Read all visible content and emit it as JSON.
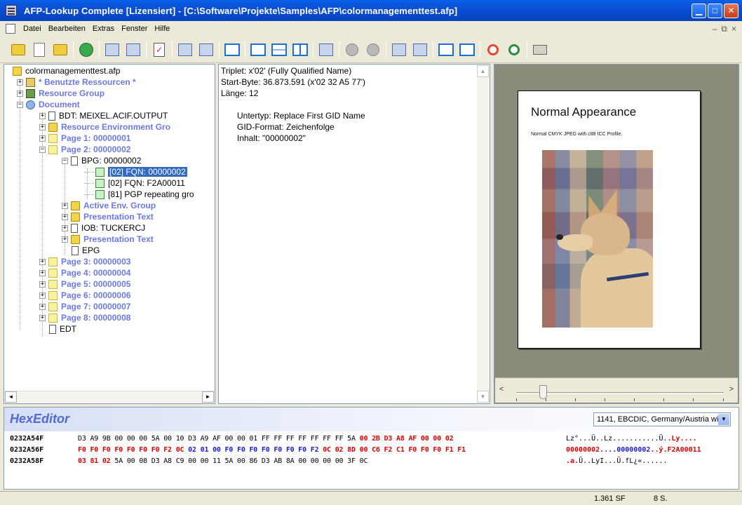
{
  "window": {
    "title": "AFP-Lookup Complete   [Lizensiert] - [C:\\Software\\Projekte\\Samples\\AFP\\colormanagementtest.afp]",
    "min": "▁",
    "max": "□",
    "close": "✕"
  },
  "menu": {
    "items": [
      "Datei",
      "Bearbeiten",
      "Extras",
      "Fenster",
      "Hilfe"
    ],
    "mdi_min": "–",
    "mdi_restore": "⧉",
    "mdi_close": "×"
  },
  "tree": {
    "items": [
      {
        "label": "colormanagementtest.afp"
      },
      {
        "label": "* Benutzte Ressourcen *"
      },
      {
        "label": "Resource Group"
      },
      {
        "label": "Document"
      },
      {
        "label": "BDT: MEIXEL.ACIF.OUTPUT"
      },
      {
        "label": "Resource Environment Gro"
      },
      {
        "label": "Page 1: 00000001"
      },
      {
        "label": "Page 2: 00000002"
      },
      {
        "label": "BPG: 00000002"
      },
      {
        "label": "[02] FQN: 00000002"
      },
      {
        "label": "[02] FQN: F2A00011"
      },
      {
        "label": "[81] PGP repeating gro"
      },
      {
        "label": "Active Env. Group"
      },
      {
        "label": "Presentation Text"
      },
      {
        "label": "IOB: TUCKERCJ"
      },
      {
        "label": "Presentation Text"
      },
      {
        "label": "EPG"
      },
      {
        "label": "Page 3: 00000003"
      },
      {
        "label": "Page 4: 00000004"
      },
      {
        "label": "Page 5: 00000005"
      },
      {
        "label": "Page 6: 00000006"
      },
      {
        "label": "Page 7: 00000007"
      },
      {
        "label": "Page 8: 00000008"
      },
      {
        "label": "EDT"
      }
    ],
    "plus": "+",
    "minus": "−",
    "scroll_left": "◄",
    "scroll_right": "►"
  },
  "info": {
    "lines": [
      "Triplet: x'02' (Fully Qualified Name)",
      "Start-Byte: 36.873.591   (x'02 32 A5 77')",
      "Länge: 12",
      "Untertyp: Replace First GID Name",
      "GID-Format: Zeichenfolge",
      "Inhalt: \"00000002\""
    ],
    "scroll_up": "▲",
    "scroll_down": "▼"
  },
  "preview": {
    "page_title": "Normal Appearance",
    "caption": "Normal CMYK JPEG with c88 ICC Profile.",
    "scroll_left": "<",
    "scroll_right": ">",
    "zoom_level": 0.13
  },
  "hex": {
    "title": "HexEditor",
    "codepage": "1141, EBCDIC, Germany/Austria wit",
    "dropdown": "▼",
    "rows": [
      {
        "addr": "0232A54F",
        "bytes_plain": "D3 A9 9B 00 00 00 5A 00 10 D3 A9 AF 00 00 01 FF FF FF FF FF FF FF 5A ",
        "bytes_red": "00 2B D3 A8 AF 00 00 02",
        "ascii_plain": "Lz°...Ü..Lz...........Ü.",
        "ascii_red": ".Ly...."
      },
      {
        "addr": "0232A56F",
        "bytes_red1": "F0 F0 F0 F0 F0 F0 F0 F2 0C ",
        "bytes_blue": "02 01 00 F0 F0 F0 F0 F0 F0 F0 F2 ",
        "bytes_red2": "0C 02 8D 00 C6 F2 C1 F0 F0 F0 F1 F1",
        "ascii_red": "00000002.",
        "ascii_blue": "...00000002",
        "ascii_red2": "..ý.F2A00011"
      },
      {
        "addr": "0232A58F",
        "bytes_red": "03 81 02 ",
        "bytes_plain": "5A 00 08 D3 A8 C9 00 00 11 5A 00 86 D3 AB 8A 00 00 00 00 3F 0C",
        "ascii_red": ".a.",
        "ascii_plain": "Ü..LyI...Ü.fL¿«......"
      }
    ]
  },
  "status": {
    "sf": "1.361 SF",
    "pages": "8 S."
  },
  "colors": {
    "titlebar": "#0b4fd6",
    "selection": "#316ac5",
    "tree_blue": "#6a78e8",
    "hex_red": "#e00000",
    "hex_blue": "#1a1ae0"
  }
}
